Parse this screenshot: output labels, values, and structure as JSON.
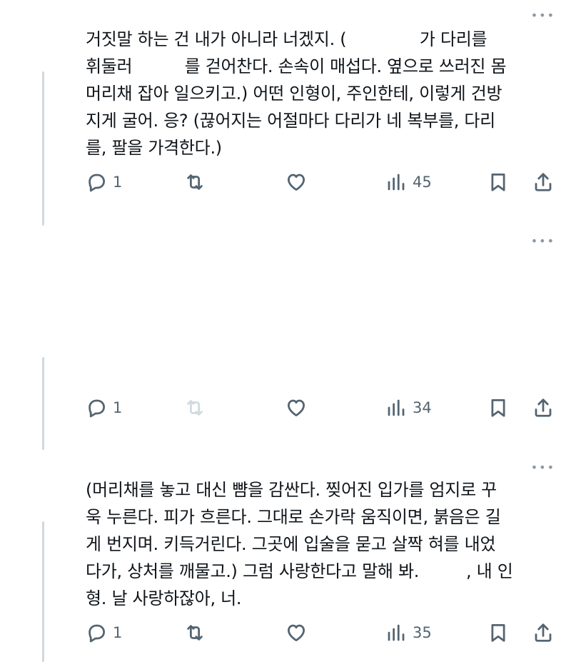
{
  "tweets": [
    {
      "text": "거짓말 하는 건 내가 아니라 너겠지. (              가 다리를\n휘둘러          를 걷어찬다. 손속이 매섭다. 옆으로 쓰러진 몸\n머리채 잡아 일으키고.) 어떤 인형이, 주인한테, 이렇게 건방\n지게 굴어. 응? (끊어지는 어절마다 다리가 네 복부를, 다리\n를, 팔을 가격한다.)",
      "more": "•••",
      "replies": "1",
      "views": "45"
    },
    {
      "text": "",
      "more": "•••",
      "replies": "1",
      "views": "34"
    },
    {
      "text": "(머리채를 놓고 대신 뺨을 감싼다. 찢어진 입가를 엄지로 꾸\n욱 누른다. 피가 흐른다. 그대로 손가락 움직이면, 붉음은 길\n게 번지며. 키득거린다. 그곳에 입술을 묻고 살짝 혀를 내었\n다가, 상처를 깨물고.) 그럼 사랑한다고 말해 봐.         , 내 인\n형. 날 사랑하잖아, 너.",
      "more": "•••",
      "replies": "1",
      "views": "35"
    }
  ],
  "icons": {
    "reply": "reply-icon",
    "retweet": "retweet-icon",
    "like": "heart-icon",
    "views": "views-icon",
    "bookmark": "bookmark-icon",
    "share": "share-icon"
  },
  "colors": {
    "text": "#0f1419",
    "icon": "#536471",
    "thread_line": "#cfd9de",
    "background": "#ffffff"
  }
}
